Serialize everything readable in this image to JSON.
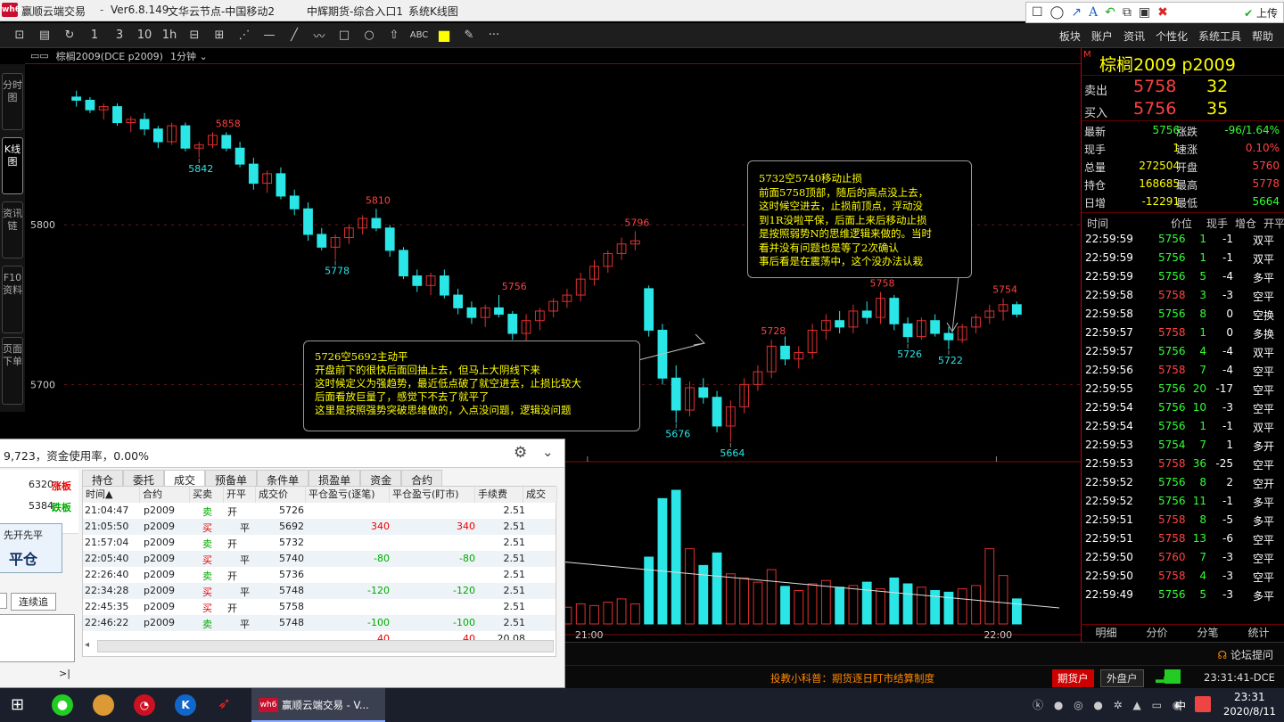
{
  "app": {
    "title": "赢顺云端交易",
    "version": "Ver6.8.149",
    "node": "文华云节点-中国移动2",
    "entry": "中辉期货-综合入口1",
    "window": "系统K线图",
    "logo": "wh6"
  },
  "drawtools": {
    "upload_label": "上传"
  },
  "toolbar": {
    "abc_label": "ABC",
    "more_label": "···",
    "menu": [
      "板块",
      "账户",
      "资讯",
      "个性化",
      "系统工具",
      "帮助"
    ]
  },
  "left_tabs": [
    "分时图",
    "K线图",
    "资讯链",
    "F10资料",
    "页面下单"
  ],
  "chart_header": {
    "symbol": "棕榈2009(DCE p2009)",
    "period": "1分钟"
  },
  "chart_data": {
    "type": "candlestick",
    "y_ticks": [
      5800,
      5700
    ],
    "x_ticks": [
      "21:00",
      "22:00"
    ],
    "price_labels": [
      {
        "text": "5858",
        "price": 5858,
        "kind": "high",
        "i": 11
      },
      {
        "text": "5842",
        "price": 5842,
        "kind": "low",
        "i": 9
      },
      {
        "text": "5810",
        "price": 5810,
        "kind": "high",
        "i": 22
      },
      {
        "text": "5778",
        "price": 5778,
        "kind": "low",
        "i": 19
      },
      {
        "text": "5796",
        "price": 5796,
        "kind": "high",
        "i": 41
      },
      {
        "text": "5756",
        "price": 5756,
        "kind": "high",
        "i": 32
      },
      {
        "text": "5726",
        "price": 5726,
        "kind": "low",
        "i": 33
      },
      {
        "text": "5676",
        "price": 5676,
        "kind": "low",
        "i": 44
      },
      {
        "text": "5664",
        "price": 5664,
        "kind": "low",
        "i": 48
      },
      {
        "text": "5728",
        "price": 5728,
        "kind": "high",
        "i": 51
      },
      {
        "text": "5758",
        "price": 5758,
        "kind": "high",
        "i": 59
      },
      {
        "text": "5726",
        "price": 5726,
        "kind": "low",
        "i": 61
      },
      {
        "text": "5722",
        "price": 5722,
        "kind": "low",
        "i": 64
      },
      {
        "text": "5754",
        "price": 5754,
        "kind": "high",
        "i": 68
      }
    ],
    "ohlc": [
      [
        5880,
        5884,
        5874,
        5878
      ],
      [
        5878,
        5880,
        5870,
        5872
      ],
      [
        5872,
        5876,
        5866,
        5874
      ],
      [
        5874,
        5876,
        5862,
        5864
      ],
      [
        5864,
        5868,
        5858,
        5866
      ],
      [
        5866,
        5870,
        5856,
        5860
      ],
      [
        5860,
        5862,
        5848,
        5852
      ],
      [
        5852,
        5864,
        5850,
        5862
      ],
      [
        5862,
        5864,
        5846,
        5848
      ],
      [
        5848,
        5852,
        5842,
        5850
      ],
      [
        5850,
        5858,
        5848,
        5856
      ],
      [
        5856,
        5858,
        5846,
        5848
      ],
      [
        5848,
        5852,
        5836,
        5838
      ],
      [
        5838,
        5842,
        5822,
        5826
      ],
      [
        5826,
        5834,
        5820,
        5832
      ],
      [
        5832,
        5836,
        5816,
        5818
      ],
      [
        5818,
        5822,
        5806,
        5810
      ],
      [
        5810,
        5814,
        5790,
        5794
      ],
      [
        5794,
        5798,
        5784,
        5786
      ],
      [
        5786,
        5794,
        5778,
        5792
      ],
      [
        5792,
        5800,
        5788,
        5798
      ],
      [
        5798,
        5806,
        5794,
        5804
      ],
      [
        5804,
        5810,
        5796,
        5798
      ],
      [
        5798,
        5800,
        5780,
        5784
      ],
      [
        5784,
        5786,
        5766,
        5768
      ],
      [
        5768,
        5772,
        5758,
        5762
      ],
      [
        5762,
        5770,
        5756,
        5768
      ],
      [
        5768,
        5772,
        5754,
        5756
      ],
      [
        5756,
        5760,
        5744,
        5748
      ],
      [
        5748,
        5752,
        5738,
        5742
      ],
      [
        5742,
        5750,
        5736,
        5748
      ],
      [
        5748,
        5756,
        5742,
        5744
      ],
      [
        5744,
        5746,
        5728,
        5732
      ],
      [
        5732,
        5744,
        5726,
        5740
      ],
      [
        5740,
        5748,
        5734,
        5746
      ],
      [
        5746,
        5754,
        5742,
        5752
      ],
      [
        5752,
        5760,
        5748,
        5756
      ],
      [
        5756,
        5770,
        5752,
        5766
      ],
      [
        5766,
        5778,
        5762,
        5774
      ],
      [
        5774,
        5784,
        5770,
        5782
      ],
      [
        5782,
        5792,
        5778,
        5788
      ],
      [
        5788,
        5796,
        5784,
        5790
      ],
      [
        5760,
        5762,
        5730,
        5734
      ],
      [
        5734,
        5738,
        5700,
        5704
      ],
      [
        5704,
        5712,
        5676,
        5684
      ],
      [
        5684,
        5702,
        5680,
        5698
      ],
      [
        5698,
        5704,
        5688,
        5692
      ],
      [
        5692,
        5696,
        5670,
        5674
      ],
      [
        5674,
        5690,
        5664,
        5686
      ],
      [
        5686,
        5704,
        5682,
        5700
      ],
      [
        5700,
        5712,
        5696,
        5708
      ],
      [
        5708,
        5728,
        5704,
        5724
      ],
      [
        5724,
        5730,
        5712,
        5716
      ],
      [
        5716,
        5724,
        5710,
        5720
      ],
      [
        5720,
        5738,
        5716,
        5734
      ],
      [
        5734,
        5744,
        5728,
        5740
      ],
      [
        5740,
        5746,
        5732,
        5736
      ],
      [
        5736,
        5750,
        5732,
        5746
      ],
      [
        5746,
        5752,
        5738,
        5742
      ],
      [
        5742,
        5758,
        5738,
        5754
      ],
      [
        5754,
        5756,
        5734,
        5738
      ],
      [
        5738,
        5742,
        5726,
        5730
      ],
      [
        5730,
        5742,
        5728,
        5740
      ],
      [
        5740,
        5744,
        5730,
        5732
      ],
      [
        5732,
        5736,
        5722,
        5728
      ],
      [
        5728,
        5738,
        5726,
        5736
      ],
      [
        5736,
        5744,
        5732,
        5742
      ],
      [
        5742,
        5750,
        5738,
        5746
      ],
      [
        5746,
        5754,
        5740,
        5750
      ],
      [
        5750,
        5752,
        5742,
        5744
      ]
    ],
    "volume": [
      22,
      18,
      14,
      20,
      16,
      24,
      18,
      12,
      16,
      20,
      14,
      18,
      22,
      26,
      18,
      20,
      24,
      30,
      22,
      16,
      18,
      20,
      14,
      22,
      26,
      20,
      18,
      16,
      22,
      24,
      18,
      16,
      20,
      28,
      18,
      16,
      20,
      24,
      22,
      26,
      30,
      24,
      80,
      150,
      160,
      90,
      70,
      85,
      60,
      55,
      50,
      65,
      45,
      40,
      48,
      52,
      44,
      46,
      50,
      42,
      55,
      48,
      44,
      40,
      38,
      42,
      46,
      90,
      58,
      30
    ],
    "ma_line": [
      70,
      68,
      66,
      64,
      62,
      60,
      58,
      56,
      54,
      52,
      50,
      48,
      46,
      44,
      42,
      40,
      38,
      36,
      34,
      32,
      30,
      28,
      26,
      24,
      22,
      20,
      18
    ]
  },
  "annotations": [
    {
      "lines": [
        "5726空5692主动平",
        "开盘前下的很快后面回抽上去，但马上大阴线下来",
        "这时候定义为强趋势，最近低点破了就空进去，止损比较大",
        "后面看放巨量了，感觉下不去了就平了",
        "这里是按照强势突破思维做的，入点没问题，逻辑没问题"
      ]
    },
    {
      "lines": [
        "5732空5740移动止损",
        "前面5758顶部，随后的高点没上去，",
        "这时候空进去，止损前顶点，浮动没",
        "到1R没啦平保，后面上来后移动止损",
        "是按照弱势N的思维逻辑来做的。当时",
        "看并没有问题也是等了2次确认",
        "事后看是在震荡中，这个没办法认栽"
      ]
    }
  ],
  "quote": {
    "name": "棕榈2009  p2009",
    "ask_label": "卖出",
    "ask_price": "5758",
    "ask_vol": "32",
    "bid_label": "买入",
    "bid_price": "5756",
    "bid_vol": "35",
    "info": [
      {
        "l1": "最新",
        "v1": "5756",
        "c1": "#3f3",
        "l2": "涨跌",
        "v2": "-96/1.64%",
        "c2": "#3f3"
      },
      {
        "l1": "现手",
        "v1": "1",
        "c1": "#ff0",
        "l2": "速涨",
        "v2": "0.10%",
        "c2": "#f44"
      },
      {
        "l1": "总量",
        "v1": "272504",
        "c1": "#ff0",
        "l2": "开盘",
        "v2": "5760",
        "c2": "#f44"
      },
      {
        "l1": "持仓",
        "v1": "168685",
        "c1": "#ff0",
        "l2": "最高",
        "v2": "5778",
        "c2": "#f44"
      },
      {
        "l1": "日增",
        "v1": "-12291",
        "c1": "#ff0",
        "l2": "最低",
        "v2": "5664",
        "c2": "#3f3"
      }
    ],
    "tick_headers": [
      "时间",
      "价位",
      "现手",
      "增仓",
      "开平"
    ],
    "ticks": [
      {
        "t": "22:59:59",
        "p": "5756",
        "v": "1",
        "d": "-1",
        "o": "双平",
        "pc": "#3f3",
        "dc": "#ddd"
      },
      {
        "t": "22:59:59",
        "p": "5756",
        "v": "1",
        "d": "-1",
        "o": "双平",
        "pc": "#3f3",
        "dc": "#ddd"
      },
      {
        "t": "22:59:59",
        "p": "5756",
        "v": "5",
        "d": "-4",
        "o": "多平",
        "pc": "#3f3",
        "dc": "#ddd"
      },
      {
        "t": "22:59:58",
        "p": "5758",
        "v": "3",
        "d": "-3",
        "o": "空平",
        "pc": "#f44",
        "dc": "#ddd"
      },
      {
        "t": "22:59:58",
        "p": "5756",
        "v": "8",
        "d": "0",
        "o": "空换",
        "pc": "#3f3",
        "dc": "#ddd"
      },
      {
        "t": "22:59:57",
        "p": "5758",
        "v": "1",
        "d": "0",
        "o": "多换",
        "pc": "#f44",
        "dc": "#ddd"
      },
      {
        "t": "22:59:57",
        "p": "5756",
        "v": "4",
        "d": "-4",
        "o": "双平",
        "pc": "#3f3",
        "dc": "#ddd"
      },
      {
        "t": "22:59:56",
        "p": "5758",
        "v": "7",
        "d": "-4",
        "o": "空平",
        "pc": "#f44",
        "dc": "#ddd"
      },
      {
        "t": "22:59:55",
        "p": "5756",
        "v": "20",
        "d": "-17",
        "o": "空平",
        "pc": "#3f3",
        "dc": "#ddd"
      },
      {
        "t": "22:59:54",
        "p": "5756",
        "v": "10",
        "d": "-3",
        "o": "空平",
        "pc": "#3f3",
        "dc": "#ddd"
      },
      {
        "t": "22:59:54",
        "p": "5756",
        "v": "1",
        "d": "-1",
        "o": "双平",
        "pc": "#3f3",
        "dc": "#ddd"
      },
      {
        "t": "22:59:53",
        "p": "5754",
        "v": "7",
        "d": "1",
        "o": "多开",
        "pc": "#3f3",
        "dc": "#ddd"
      },
      {
        "t": "22:59:53",
        "p": "5758",
        "v": "36",
        "d": "-25",
        "o": "空平",
        "pc": "#f44",
        "dc": "#ddd"
      },
      {
        "t": "22:59:52",
        "p": "5756",
        "v": "8",
        "d": "2",
        "o": "空开",
        "pc": "#3f3",
        "dc": "#ddd"
      },
      {
        "t": "22:59:52",
        "p": "5756",
        "v": "11",
        "d": "-1",
        "o": "多平",
        "pc": "#3f3",
        "dc": "#ddd"
      },
      {
        "t": "22:59:51",
        "p": "5758",
        "v": "8",
        "d": "-5",
        "o": "多平",
        "pc": "#f44",
        "dc": "#ddd"
      },
      {
        "t": "22:59:51",
        "p": "5758",
        "v": "13",
        "d": "-6",
        "o": "空平",
        "pc": "#f44",
        "dc": "#ddd"
      },
      {
        "t": "22:59:50",
        "p": "5760",
        "v": "7",
        "d": "-3",
        "o": "空平",
        "pc": "#f44",
        "dc": "#ddd"
      },
      {
        "t": "22:59:50",
        "p": "5758",
        "v": "4",
        "d": "-3",
        "o": "空平",
        "pc": "#f44",
        "dc": "#ddd"
      },
      {
        "t": "22:59:49",
        "p": "5756",
        "v": "5",
        "d": "-3",
        "o": "多平",
        "pc": "#3f3",
        "dc": "#ddd"
      }
    ],
    "bottom_tabs": [
      "明细",
      "分价",
      "分笔",
      "统计"
    ]
  },
  "panel": {
    "title_text": "9,723，资金使用率，0.00%",
    "limit_up_value": "6320",
    "limit_up_label": "涨板",
    "limit_down_value": "5384",
    "limit_down_label": "跌板",
    "mode_label": "先开先平",
    "close_label": "平仓",
    "chase_label": "连续追",
    "scroll_arrow": ">|",
    "tabs": [
      "持仓",
      "委托",
      "成交",
      "预备单",
      "条件单",
      "损盈单",
      "资金",
      "合约"
    ],
    "active_tab": 2,
    "columns": [
      "时间▲",
      "合约",
      "买卖",
      "开平",
      "成交价",
      "平仓盈亏(逐笔)",
      "平仓盈亏(盯市)",
      "手续费",
      "成交"
    ],
    "rows": [
      {
        "time": "21:04:47",
        "contract": "p2009",
        "side": "卖",
        "oc": "开",
        "price": "5726",
        "pnl1": "",
        "pnl2": "",
        "fee": "2.51"
      },
      {
        "time": "21:05:50",
        "contract": "p2009",
        "side": "买",
        "oc": "平",
        "price": "5692",
        "pnl1": "340",
        "pnl2": "340",
        "fee": "2.51"
      },
      {
        "time": "21:57:04",
        "contract": "p2009",
        "side": "卖",
        "oc": "开",
        "price": "5732",
        "pnl1": "",
        "pnl2": "",
        "fee": "2.51"
      },
      {
        "time": "22:05:40",
        "contract": "p2009",
        "side": "买",
        "oc": "平",
        "price": "5740",
        "pnl1": "-80",
        "pnl2": "-80",
        "fee": "2.51"
      },
      {
        "time": "22:26:40",
        "contract": "p2009",
        "side": "卖",
        "oc": "开",
        "price": "5736",
        "pnl1": "",
        "pnl2": "",
        "fee": "2.51"
      },
      {
        "time": "22:34:28",
        "contract": "p2009",
        "side": "买",
        "oc": "平",
        "price": "5748",
        "pnl1": "-120",
        "pnl2": "-120",
        "fee": "2.51"
      },
      {
        "time": "22:45:35",
        "contract": "p2009",
        "side": "买",
        "oc": "开",
        "price": "5758",
        "pnl1": "",
        "pnl2": "",
        "fee": "2.51"
      },
      {
        "time": "22:46:22",
        "contract": "p2009",
        "side": "卖",
        "oc": "平",
        "price": "5748",
        "pnl1": "-100",
        "pnl2": "-100",
        "fee": "2.51"
      }
    ],
    "total": {
      "pnl1": "40",
      "pnl2": "40",
      "fee": "20.08"
    }
  },
  "status": {
    "forum_label": "论坛提问",
    "tip_text": "投教小科普：期货逐日盯市结算制度",
    "futures_btn": "期货户",
    "foreign_btn": "外盘户",
    "clock": "23:31:41-DCE"
  },
  "taskbar": {
    "app_label": "赢顺云端交易 - V...",
    "ime": "中",
    "time": "23:31",
    "date": "2020/8/11"
  }
}
